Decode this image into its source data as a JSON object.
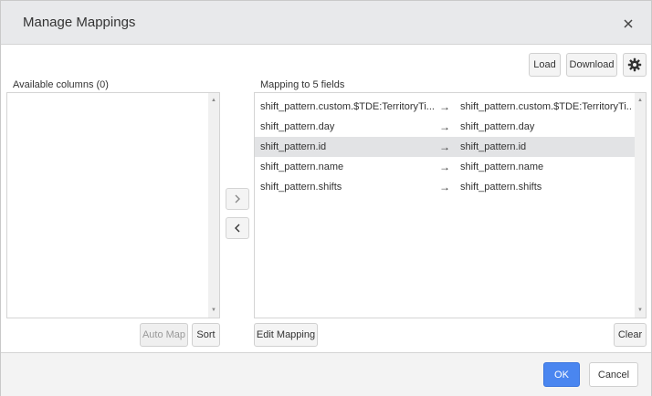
{
  "dialog": {
    "title": "Manage Mappings"
  },
  "toolbar": {
    "load_label": "Load",
    "download_label": "Download"
  },
  "left_panel": {
    "label": "Available columns (0)",
    "auto_map_label": "Auto Map",
    "sort_label": "Sort"
  },
  "right_panel": {
    "label": "Mapping to 5 fields",
    "edit_mapping_label": "Edit Mapping",
    "clear_label": "Clear",
    "rows": [
      {
        "source": "shift_pattern.custom.$TDE:TerritoryTi...",
        "arrow": "→",
        "target": "shift_pattern.custom.$TDE:TerritoryTi...",
        "selected": false
      },
      {
        "source": "shift_pattern.day",
        "arrow": "→",
        "target": "shift_pattern.day",
        "selected": false
      },
      {
        "source": "shift_pattern.id",
        "arrow": "→",
        "target": "shift_pattern.id",
        "selected": true
      },
      {
        "source": "shift_pattern.name",
        "arrow": "→",
        "target": "shift_pattern.name",
        "selected": false
      },
      {
        "source": "shift_pattern.shifts",
        "arrow": "→",
        "target": "shift_pattern.shifts",
        "selected": false
      }
    ]
  },
  "footer": {
    "ok_label": "OK",
    "cancel_label": "Cancel"
  },
  "colors": {
    "primary": "#4a86f0",
    "selected_row": "#e2e3e5",
    "header_bg": "#e8e9eb"
  }
}
